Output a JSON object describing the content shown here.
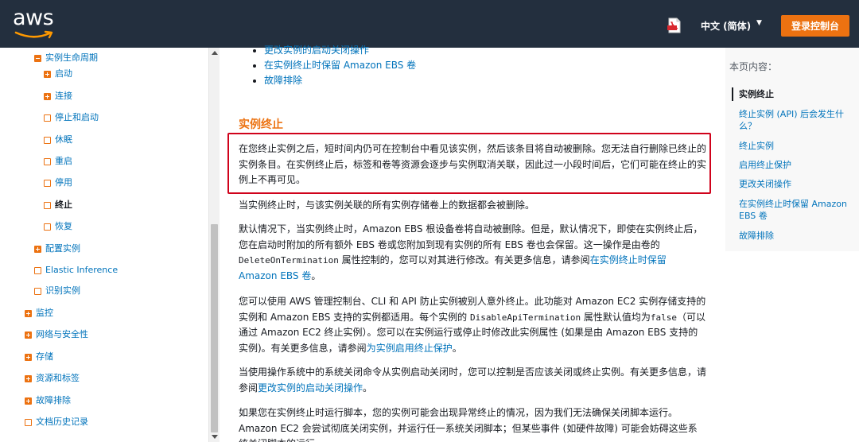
{
  "header": {
    "logo_text": "aws",
    "language": "中文 (简体)",
    "login_button": "登录控制台",
    "brand_color": "#232f3e",
    "accent_color": "#ec7211",
    "icons": [
      "pdf-icon",
      "caret-down-icon"
    ]
  },
  "sidebar": {
    "items": [
      {
        "label": "实例生命周期",
        "type": "minus"
      },
      {
        "label": "启动",
        "type": "plus"
      },
      {
        "label": "连接",
        "type": "plus"
      },
      {
        "label": "停止和启动",
        "type": "leaf"
      },
      {
        "label": "休眠",
        "type": "leaf"
      },
      {
        "label": "重启",
        "type": "leaf"
      },
      {
        "label": "停用",
        "type": "leaf"
      },
      {
        "label": "终止",
        "type": "leaf",
        "active": true
      },
      {
        "label": "恢复",
        "type": "leaf"
      },
      {
        "label": "配置实例",
        "type": "plus"
      },
      {
        "label": "Elastic Inference",
        "type": "leaf"
      },
      {
        "label": "识别实例",
        "type": "leaf"
      },
      {
        "label": "监控",
        "type": "plus"
      },
      {
        "label": "网络与安全性",
        "type": "plus"
      },
      {
        "label": "存储",
        "type": "plus"
      },
      {
        "label": "资源和标签",
        "type": "plus"
      },
      {
        "label": "故障排除",
        "type": "plus"
      },
      {
        "label": "文档历史记录",
        "type": "leaf"
      }
    ]
  },
  "main": {
    "bullets": [
      "更改实例的启动关闭操作",
      "在实例终止时保留 Amazon EBS 卷",
      "故障排除"
    ],
    "section_title": "实例终止",
    "p1": "在您终止实例之后，短时间内仍可在控制台中看见该实例，然后该条目将自动被删除。您无法自行删除已终止的实例条目。在实例终止后，标签和卷等资源会逐步与实例取消关联，因此过一小段时间后，它们可能在终止的实例上不再可见。",
    "p2": "当实例终止时，与该实例关联的所有实例存储卷上的数据都会被删除。",
    "p3_a": "默认情况下，当实例终止时，Amazon EBS 根设备卷将自动被删除。但是，默认情况下，即使在实例终止后，您在启动时附加的所有额外 EBS 卷或您附加到现有实例的所有 EBS 卷也会保留。这一操作是由卷的",
    "p3_code": "DeleteOnTermination",
    "p3_b": "属性控制的，您可以对其进行修改。有关更多信息，请参阅",
    "p3_link": "在实例终止时保留 Amazon EBS 卷",
    "p3_c": "。",
    "p4_a": "您可以使用 AWS 管理控制台、CLI 和 API 防止实例被别人意外终止。此功能对 Amazon EC2 实例存储支持的实例和 Amazon EBS 支持的实例都适用。每个实例的",
    "p4_code": "DisableApiTermination",
    "p4_b": "属性默认值均为",
    "p4_code2": "false",
    "p4_c": "（可以通过 Amazon EC2 终止实例）。您可以在实例运行或停止时修改此实例属性 (如果是由 Amazon EBS 支持的实例)。有关更多信息，请参阅",
    "p4_link": "为实例启用终止保护",
    "p4_d": "。",
    "p5_a": "当使用操作系统中的系统关闭命令从实例启动关闭时，您可以控制是否应该关闭或终止实例。有关更多信息，请参阅",
    "p5_link": "更改实例的启动关闭操作",
    "p5_b": "。",
    "p6": "如果您在实例终止时运行脚本，您的实例可能会出现异常终止的情况，因为我们无法确保关闭脚本运行。Amazon EC2 会尝试彻底关闭实例，并运行任一系统关闭脚本；但某些事件 (如硬件故障) 可能会妨碍这些系统关闭脚本的运行。",
    "highlight_color": "#d0021b"
  },
  "toc": {
    "title": "本页内容：",
    "items": [
      {
        "label": "实例终止",
        "active": true
      },
      {
        "label": "终止实例 (API) 后会发生什么？"
      },
      {
        "label": "终止实例"
      },
      {
        "label": "启用终止保护"
      },
      {
        "label": "更改关闭操作"
      },
      {
        "label": "在实例终止时保留 Amazon EBS 卷"
      },
      {
        "label": "故障排除"
      }
    ]
  }
}
